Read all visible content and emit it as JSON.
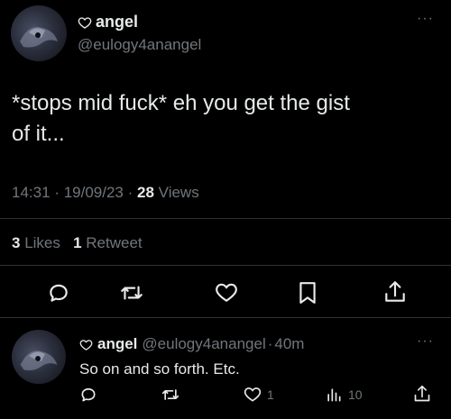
{
  "main_tweet": {
    "author_name": "angel",
    "author_handle": "@eulogy4anangel",
    "more_label": "···",
    "text_line1": "*stops mid fuck* eh you get the gist",
    "text_line2": "of it...",
    "time": "14:31",
    "sep1": "·",
    "date": "19/09/23",
    "sep2": "·",
    "views_count": "28",
    "views_label": "Views",
    "likes_count": "3",
    "likes_label": "Likes",
    "retweets_count": "1",
    "retweets_label": "Retweet",
    "actions": [
      "reply-icon",
      "retweet-icon",
      "like-icon",
      "bookmark-icon",
      "share-icon"
    ]
  },
  "reply_tweet": {
    "author_name": "angel",
    "author_handle": "@eulogy4anangel",
    "sep": "·",
    "time_ago": "40m",
    "more_label": "···",
    "text": "So on and so forth. Etc.",
    "like_count": "1",
    "views_count": "10",
    "actions": [
      "reply-icon",
      "retweet-icon",
      "like-icon",
      "views-icon",
      "share-icon"
    ]
  },
  "colors": {
    "background": "#000000",
    "text": "#e7e9ea",
    "muted": "#71767b",
    "divider": "#2f3336"
  }
}
